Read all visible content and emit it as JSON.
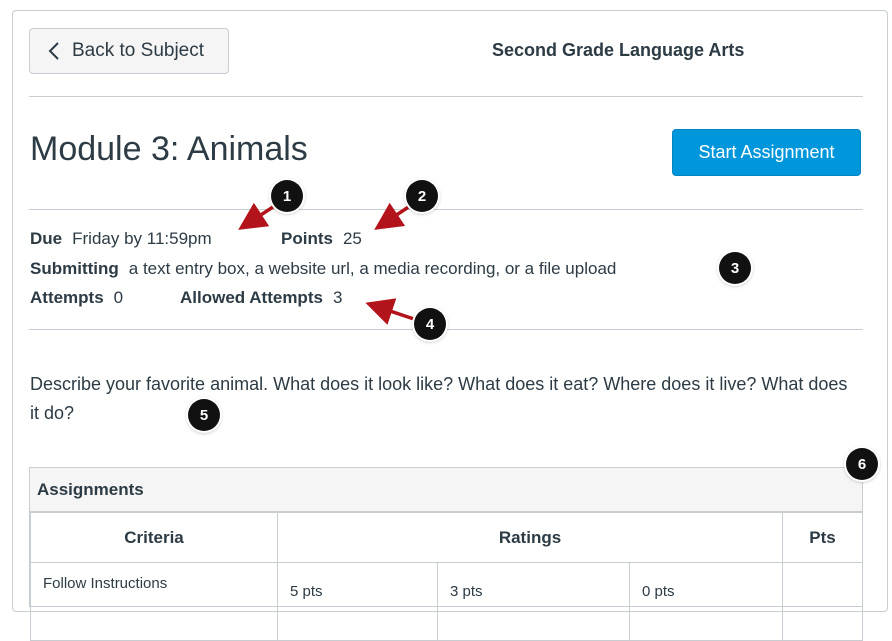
{
  "header": {
    "back_label": "Back to Subject",
    "subject_title": "Second Grade Language Arts"
  },
  "assignment": {
    "title": "Module 3: Animals",
    "start_label": "Start Assignment",
    "due_label": "Due",
    "due_value": "Friday by 11:59pm",
    "points_label": "Points",
    "points_value": "25",
    "submitting_label": "Submitting",
    "submitting_value": "a text entry box, a website url, a media recording, or a file upload",
    "attempts_label": "Attempts",
    "attempts_value": "0",
    "allowed_label": "Allowed Attempts",
    "allowed_value": "3",
    "description": "Describe your favorite animal. What does it look like? What does it eat? Where does it live? What does it do?"
  },
  "rubric": {
    "title": "Assignments",
    "columns": [
      "Criteria",
      "Ratings",
      "Pts"
    ],
    "rows": [
      {
        "criterion": "Follow Instructions",
        "ratings": [
          "5 pts",
          "3 pts",
          "0 pts"
        ],
        "pts": ""
      }
    ]
  },
  "callouts": [
    "1",
    "2",
    "3",
    "4",
    "5",
    "6"
  ],
  "colors": {
    "accent": "#0096db",
    "callout_arrow": "#b3141b",
    "callout_badge": "#111111"
  }
}
